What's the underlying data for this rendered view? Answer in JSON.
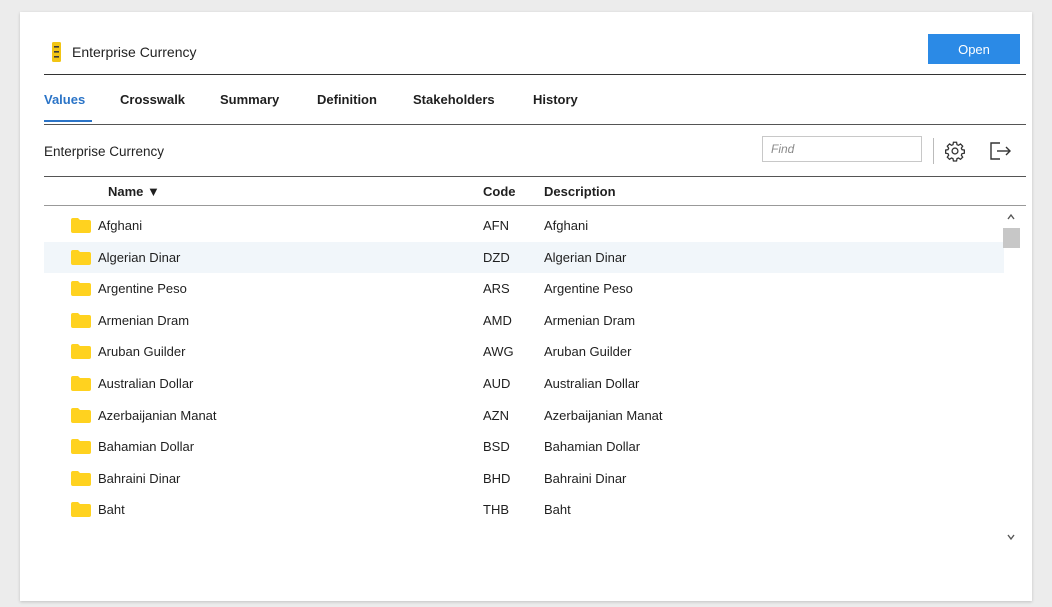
{
  "header": {
    "title": "Enterprise Currency",
    "open_label": "Open",
    "accent": "#2b8ae6"
  },
  "tabs": [
    {
      "label": "Values",
      "active": true
    },
    {
      "label": "Crosswalk",
      "active": false
    },
    {
      "label": "Summary",
      "active": false
    },
    {
      "label": "Definition",
      "active": false
    },
    {
      "label": "Stakeholders",
      "active": false
    },
    {
      "label": "History",
      "active": false
    }
  ],
  "toolbar": {
    "section_title": "Enterprise Currency",
    "find_placeholder": "Find",
    "icons": [
      "gear-icon",
      "exit-icon"
    ]
  },
  "table": {
    "columns": {
      "name": "Name ▼",
      "code": "Code",
      "description": "Description"
    },
    "rows": [
      {
        "name": "Afghani",
        "code": "AFN",
        "description": "Afghani"
      },
      {
        "name": "Algerian Dinar",
        "code": "DZD",
        "description": "Algerian Dinar",
        "highlighted": true
      },
      {
        "name": "Argentine Peso",
        "code": "ARS",
        "description": "Argentine Peso"
      },
      {
        "name": "Armenian Dram",
        "code": "AMD",
        "description": "Armenian Dram"
      },
      {
        "name": "Aruban Guilder",
        "code": "AWG",
        "description": "Aruban Guilder"
      },
      {
        "name": "Australian Dollar",
        "code": "AUD",
        "description": "Australian Dollar"
      },
      {
        "name": "Azerbaijanian Manat",
        "code": "AZN",
        "description": "Azerbaijanian Manat"
      },
      {
        "name": "Bahamian Dollar",
        "code": "BSD",
        "description": "Bahamian Dollar"
      },
      {
        "name": "Bahraini Dinar",
        "code": "BHD",
        "description": "Bahraini Dinar"
      },
      {
        "name": "Baht",
        "code": "THB",
        "description": "Baht"
      }
    ]
  },
  "colors": {
    "folder": "#ffd21f",
    "highlight_row": "#f1f6fa",
    "active_tab": "#2b74c7"
  }
}
